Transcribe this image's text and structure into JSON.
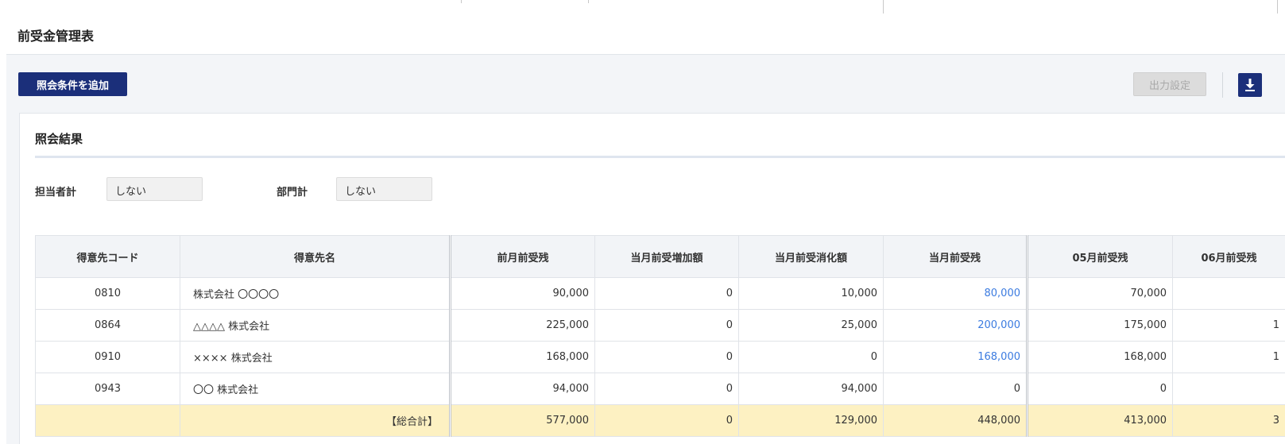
{
  "page": {
    "title": "前受金管理表"
  },
  "toolbar": {
    "add_condition_label": "照会条件を追加",
    "output_settings_label": "出力設定",
    "download_icon": "download-icon"
  },
  "result": {
    "title": "照会結果",
    "filters": [
      {
        "label": "担当者計",
        "value": "しない"
      },
      {
        "label": "部門計",
        "value": "しない"
      }
    ]
  },
  "table": {
    "columns": [
      "得意先コード",
      "得意先名",
      "前月前受残",
      "当月前受増加額",
      "当月前受消化額",
      "当月前受残",
      "05月前受残",
      "06月前受残"
    ],
    "rows": [
      {
        "code": "0810",
        "name": "株式会社 〇〇〇〇",
        "prev": "90,000",
        "inc": "0",
        "cons": "10,000",
        "curr": "80,000",
        "m05": "70,000",
        "m06": ""
      },
      {
        "code": "0864",
        "name": "△△△△ 株式会社",
        "prev": "225,000",
        "inc": "0",
        "cons": "25,000",
        "curr": "200,000",
        "m05": "175,000",
        "m06": "1"
      },
      {
        "code": "0910",
        "name": "×××× 株式会社",
        "prev": "168,000",
        "inc": "0",
        "cons": "0",
        "curr": "168,000",
        "m05": "168,000",
        "m06": "1"
      },
      {
        "code": "0943",
        "name": "〇〇 株式会社",
        "prev": "94,000",
        "inc": "0",
        "cons": "94,000",
        "curr": "0",
        "m05": "0",
        "m06": ""
      }
    ],
    "total": {
      "label": "【総合計】",
      "prev": "577,000",
      "inc": "0",
      "cons": "129,000",
      "curr": "448,000",
      "m05": "413,000",
      "m06": "3"
    }
  },
  "colors": {
    "primary": "#1b2f7a",
    "link": "#3b7be0",
    "total_row": "#fdf1c2"
  }
}
